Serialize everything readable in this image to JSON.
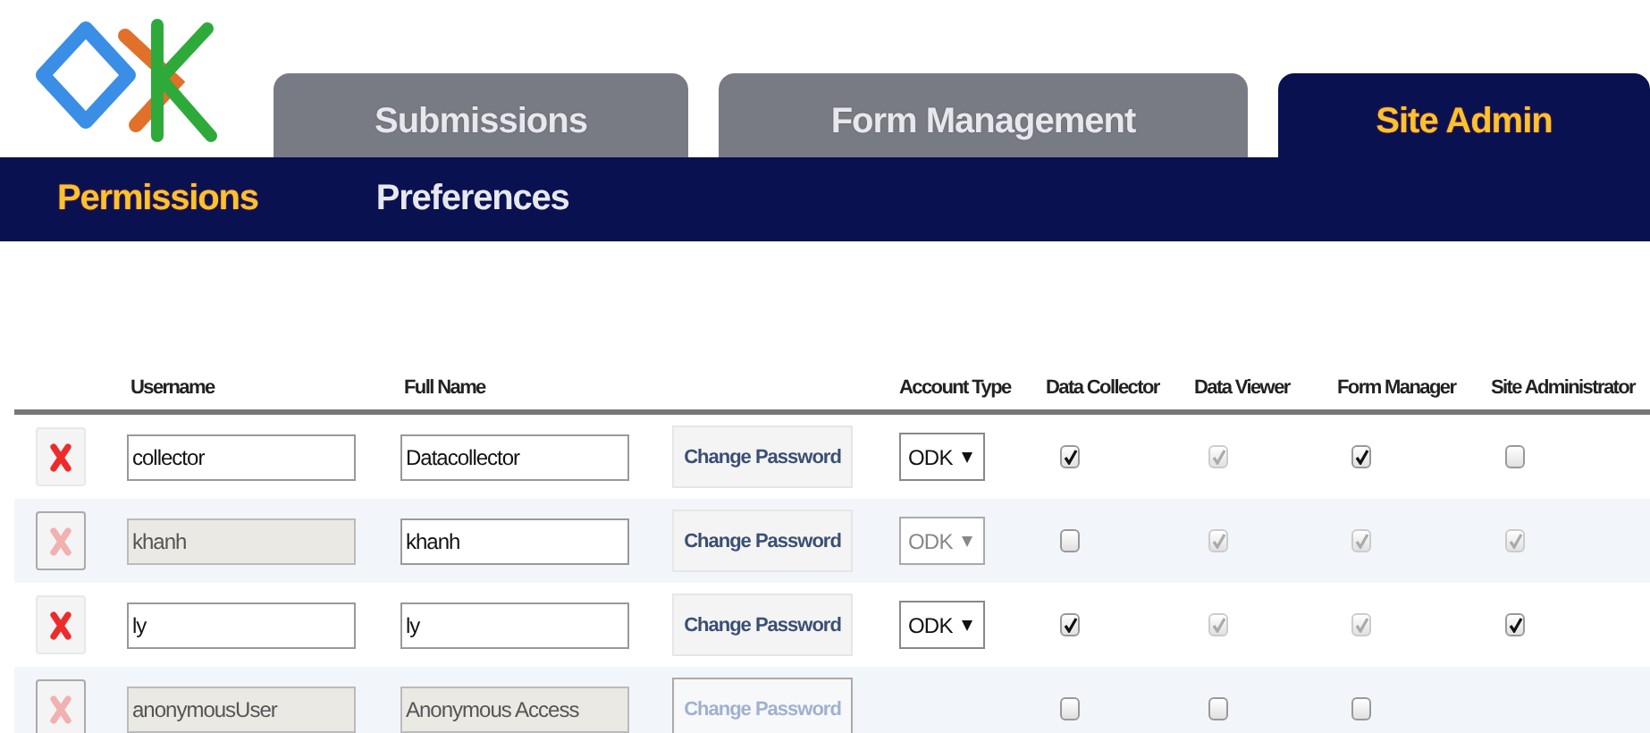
{
  "tabs": [
    {
      "label": "Submissions",
      "selected": false
    },
    {
      "label": "Form Management",
      "selected": false
    },
    {
      "label": "Site Admin",
      "selected": true
    }
  ],
  "subnav": [
    {
      "label": "Permissions",
      "selected": true
    },
    {
      "label": "Preferences",
      "selected": false
    }
  ],
  "table": {
    "columns": [
      "Username",
      "Full Name",
      "Account Type",
      "Data Collector",
      "Data Viewer",
      "Form Manager",
      "Site Administrator"
    ],
    "rows": [
      {
        "delete_disabled": false,
        "username": {
          "value": "collector",
          "disabled": false
        },
        "full_name": {
          "value": "Datacollector",
          "disabled": false
        },
        "password_button": {
          "label": "Change Password",
          "disabled": false
        },
        "account_type": {
          "value": "ODK",
          "disabled": false
        },
        "roles": [
          {
            "checked": true,
            "disabled": false
          },
          {
            "checked": true,
            "disabled": true
          },
          {
            "checked": true,
            "disabled": false
          },
          {
            "checked": false,
            "disabled": false
          }
        ]
      },
      {
        "delete_disabled": true,
        "username": {
          "value": "khanh",
          "disabled": true
        },
        "full_name": {
          "value": "khanh",
          "disabled": false
        },
        "password_button": {
          "label": "Change Password",
          "disabled": false
        },
        "account_type": {
          "value": "ODK",
          "disabled": true
        },
        "roles": [
          {
            "checked": false,
            "disabled": false
          },
          {
            "checked": true,
            "disabled": true
          },
          {
            "checked": true,
            "disabled": true
          },
          {
            "checked": true,
            "disabled": true
          }
        ]
      },
      {
        "delete_disabled": false,
        "username": {
          "value": "ly",
          "disabled": false
        },
        "full_name": {
          "value": "ly",
          "disabled": false
        },
        "password_button": {
          "label": "Change Password",
          "disabled": false
        },
        "account_type": {
          "value": "ODK",
          "disabled": false
        },
        "roles": [
          {
            "checked": true,
            "disabled": false
          },
          {
            "checked": true,
            "disabled": true
          },
          {
            "checked": true,
            "disabled": true
          },
          {
            "checked": true,
            "disabled": false
          }
        ]
      },
      {
        "delete_disabled": true,
        "username": {
          "value": "anonymousUser",
          "disabled": true
        },
        "full_name": {
          "value": "Anonymous Access",
          "disabled": true
        },
        "password_button": {
          "label": "Change Password",
          "disabled": true
        },
        "roles": [
          {
            "checked": false,
            "disabled": false
          },
          {
            "checked": false,
            "disabled": false
          },
          {
            "checked": false,
            "disabled": false
          }
        ]
      }
    ]
  }
}
